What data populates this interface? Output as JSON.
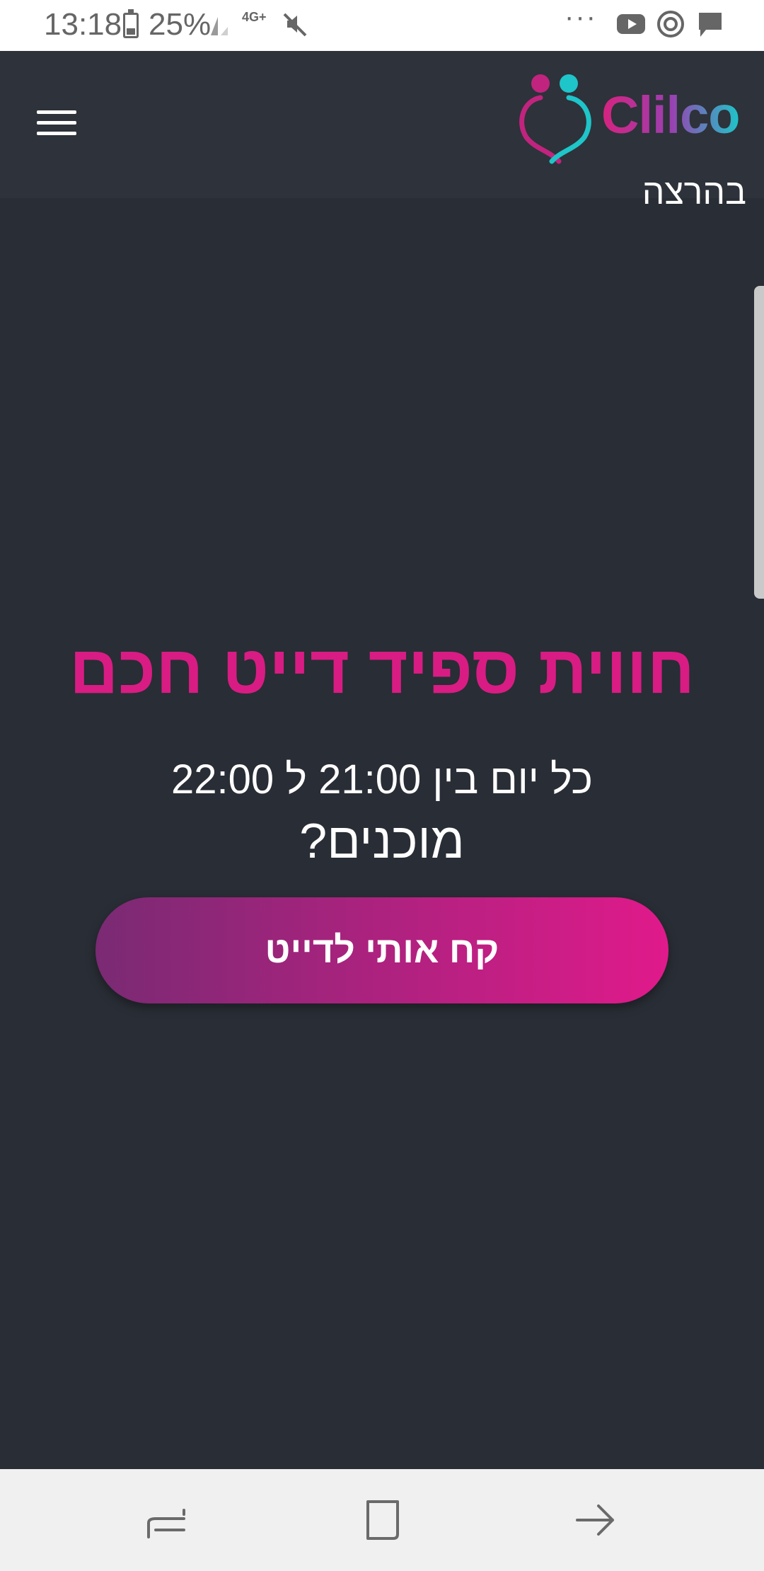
{
  "status_bar": {
    "time": "13:18",
    "battery": "25%",
    "network": "4G+",
    "overflow": "···",
    "icons": [
      "battery-icon",
      "signal-icon",
      "mute-icon",
      "youtube-icon",
      "sync-icon",
      "message-icon"
    ]
  },
  "header": {
    "logo_text": "Clilco",
    "logo_subtitle": "בהרצה",
    "menu_icon": "hamburger-menu-icon"
  },
  "main": {
    "headline": "חווית ספיד דייט חכם",
    "subline": "כל יום בין 21:00 ל 22:00",
    "question": "מוכנים?",
    "cta_label": "קח אותי לדייט"
  },
  "nav_bar": {
    "icons": [
      "recent-apps-icon",
      "home-icon",
      "back-icon"
    ]
  },
  "colors": {
    "background": "#292d35",
    "header": "#2e323a",
    "accent": "#d81c84",
    "cta_start": "#7a2a73",
    "cta_end": "#e01a8a"
  }
}
